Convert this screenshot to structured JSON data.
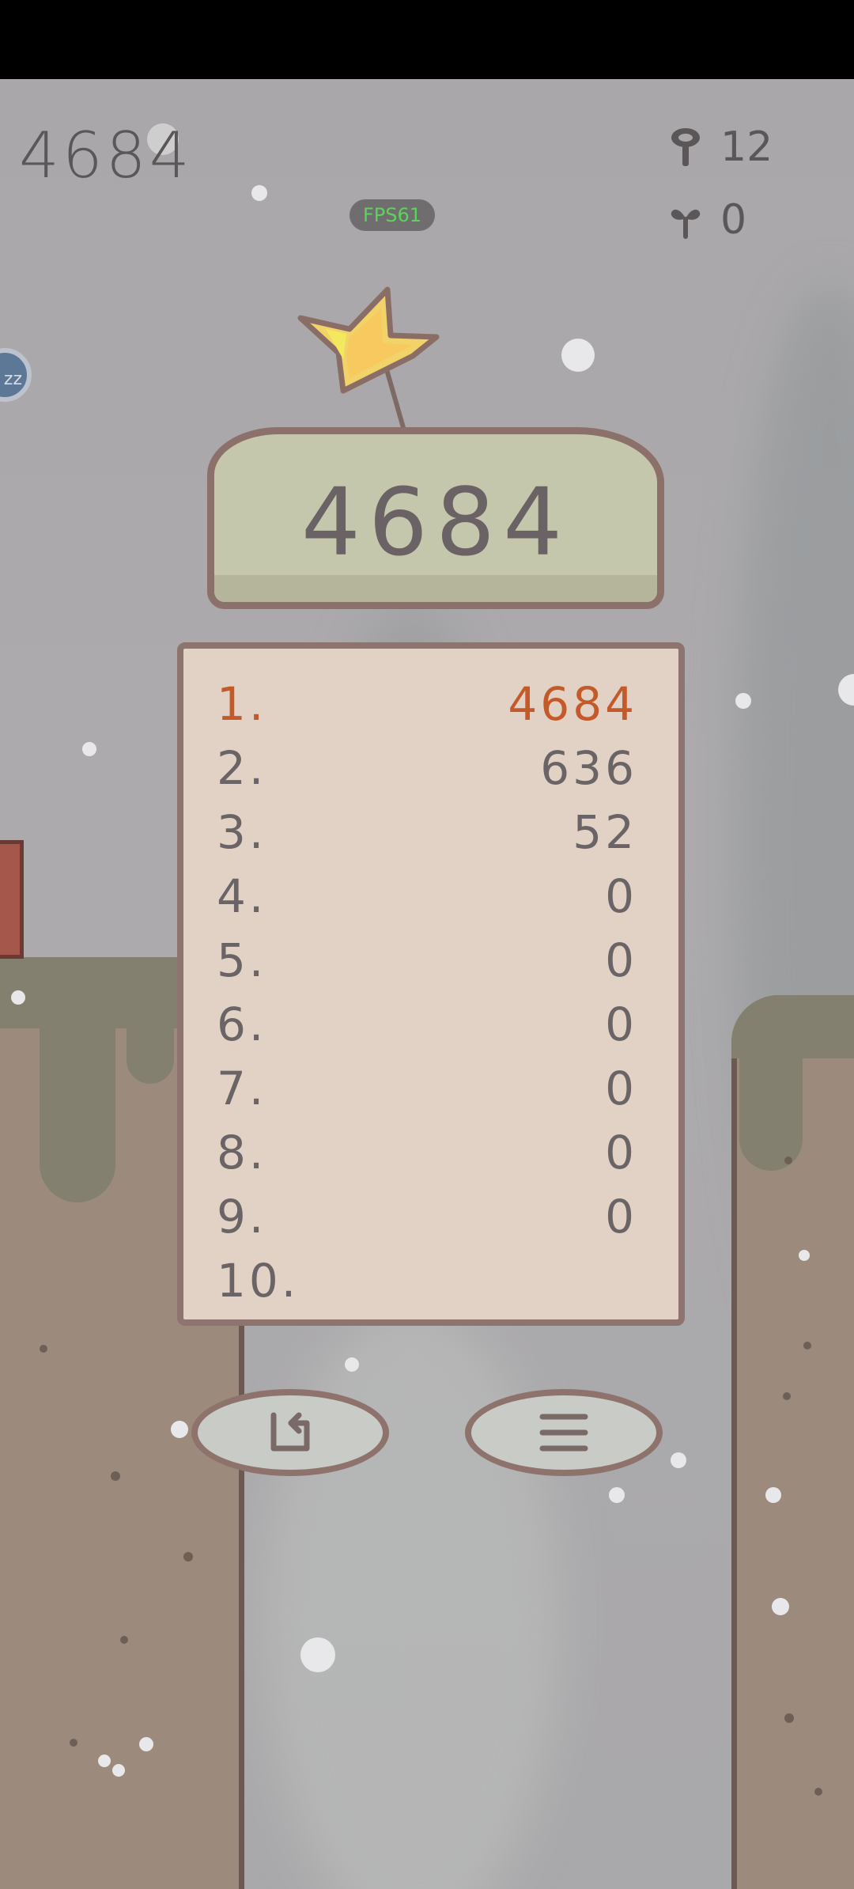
{
  "hud": {
    "score": "4684",
    "fps_label": "FPS61",
    "sleep_badge": "zz",
    "resources": [
      {
        "icon": "mushroom-icon",
        "count": "12"
      },
      {
        "icon": "sprout-icon",
        "count": "0"
      }
    ]
  },
  "result": {
    "score": "4684"
  },
  "leaderboard": [
    {
      "rank": "1.",
      "score": "4684"
    },
    {
      "rank": "2.",
      "score": "636"
    },
    {
      "rank": "3.",
      "score": "52"
    },
    {
      "rank": "4.",
      "score": "0"
    },
    {
      "rank": "5.",
      "score": "0"
    },
    {
      "rank": "6.",
      "score": "0"
    },
    {
      "rank": "7.",
      "score": "0"
    },
    {
      "rank": "8.",
      "score": "0"
    },
    {
      "rank": "9.",
      "score": "0"
    },
    {
      "rank": "10.",
      "score": ""
    }
  ],
  "buttons": {
    "restart_icon": "restart-arrow-icon",
    "menu_icon": "menu-icon"
  },
  "colors": {
    "highlight_score": "#c45a2a",
    "fps_text": "#5bd45b"
  }
}
